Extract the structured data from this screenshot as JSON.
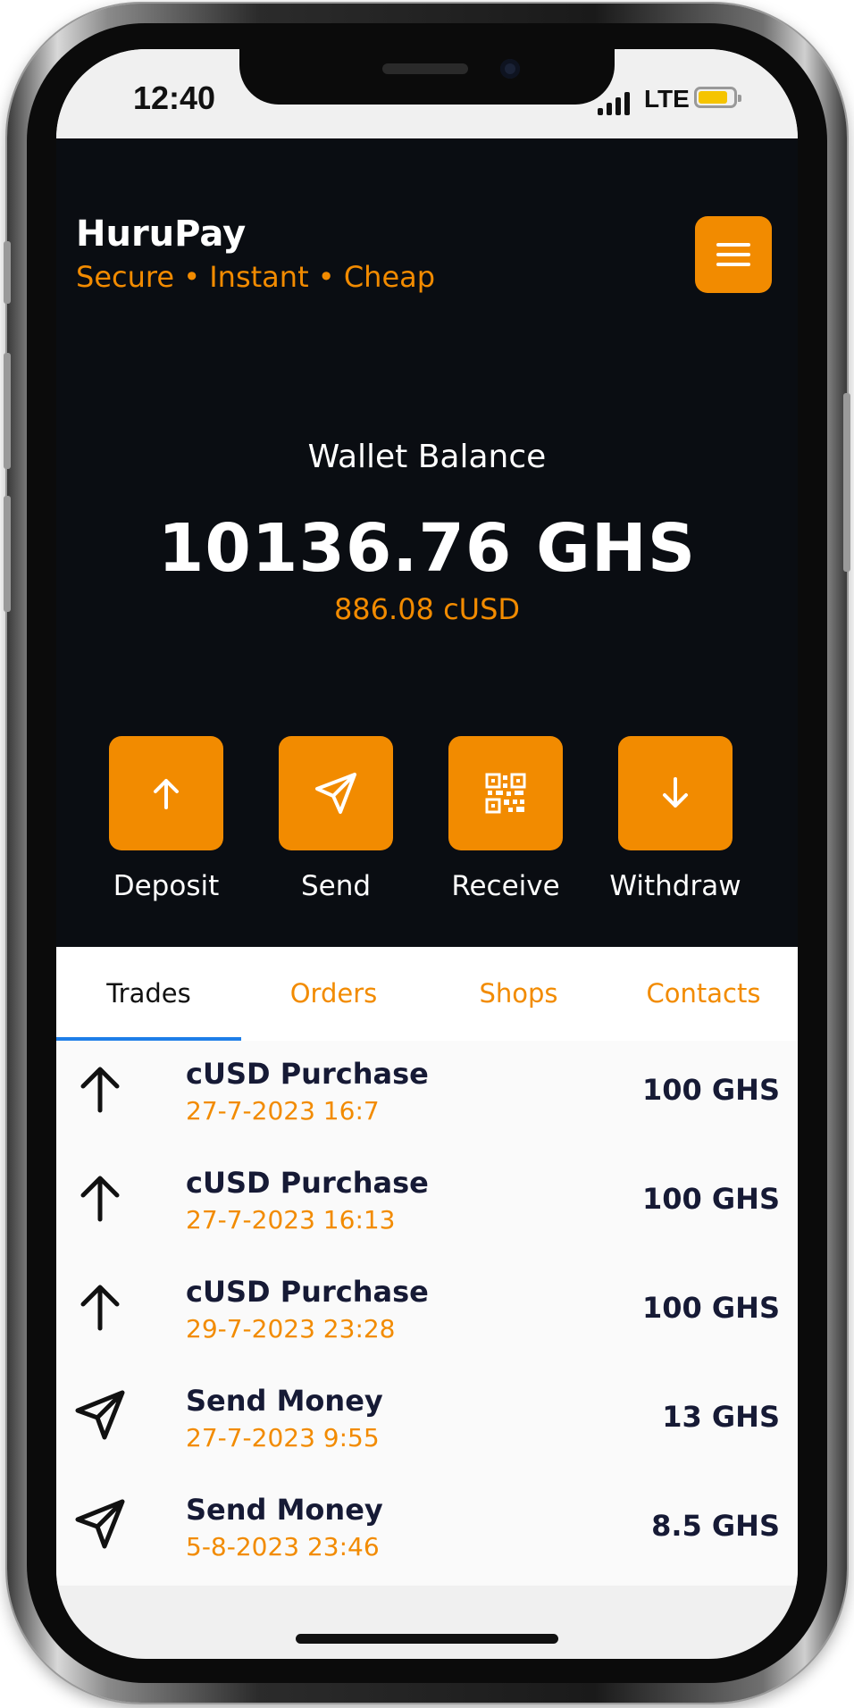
{
  "status_bar": {
    "time": "12:40",
    "network": "LTE",
    "battery_color": "#f5c400"
  },
  "header": {
    "app_name": "HuruPay",
    "tagline": "Secure • Instant • Cheap",
    "menu_icon": "hamburger-menu-icon"
  },
  "wallet": {
    "label": "Wallet Balance",
    "balance": "10136.76 GHS",
    "secondary_balance": "886.08 cUSD"
  },
  "actions": [
    {
      "label": "Deposit",
      "icon": "arrow-up-icon"
    },
    {
      "label": "Send",
      "icon": "paper-plane-icon"
    },
    {
      "label": "Receive",
      "icon": "qr-code-icon"
    },
    {
      "label": "Withdraw",
      "icon": "arrow-down-icon"
    }
  ],
  "tabs": [
    {
      "label": "Trades",
      "active": true
    },
    {
      "label": "Orders",
      "active": false
    },
    {
      "label": "Shops",
      "active": false
    },
    {
      "label": "Contacts",
      "active": false
    }
  ],
  "transactions": [
    {
      "title": "cUSD Purchase",
      "date": "27-7-2023 16:7",
      "amount": "100 GHS",
      "icon": "arrow-up-icon"
    },
    {
      "title": "cUSD Purchase",
      "date": "27-7-2023 16:13",
      "amount": "100 GHS",
      "icon": "arrow-up-icon"
    },
    {
      "title": "cUSD Purchase",
      "date": "29-7-2023 23:28",
      "amount": "100 GHS",
      "icon": "arrow-up-icon"
    },
    {
      "title": "Send Money",
      "date": "27-7-2023 9:55",
      "amount": "13 GHS",
      "icon": "paper-plane-icon"
    },
    {
      "title": "Send Money",
      "date": "5-8-2023 23:46",
      "amount": "8.5 GHS",
      "icon": "paper-plane-icon"
    }
  ],
  "colors": {
    "accent": "#f28b00",
    "dark_background": "#0a0d12",
    "tab_indicator": "#1e7ee8",
    "text_dark": "#161a35"
  }
}
